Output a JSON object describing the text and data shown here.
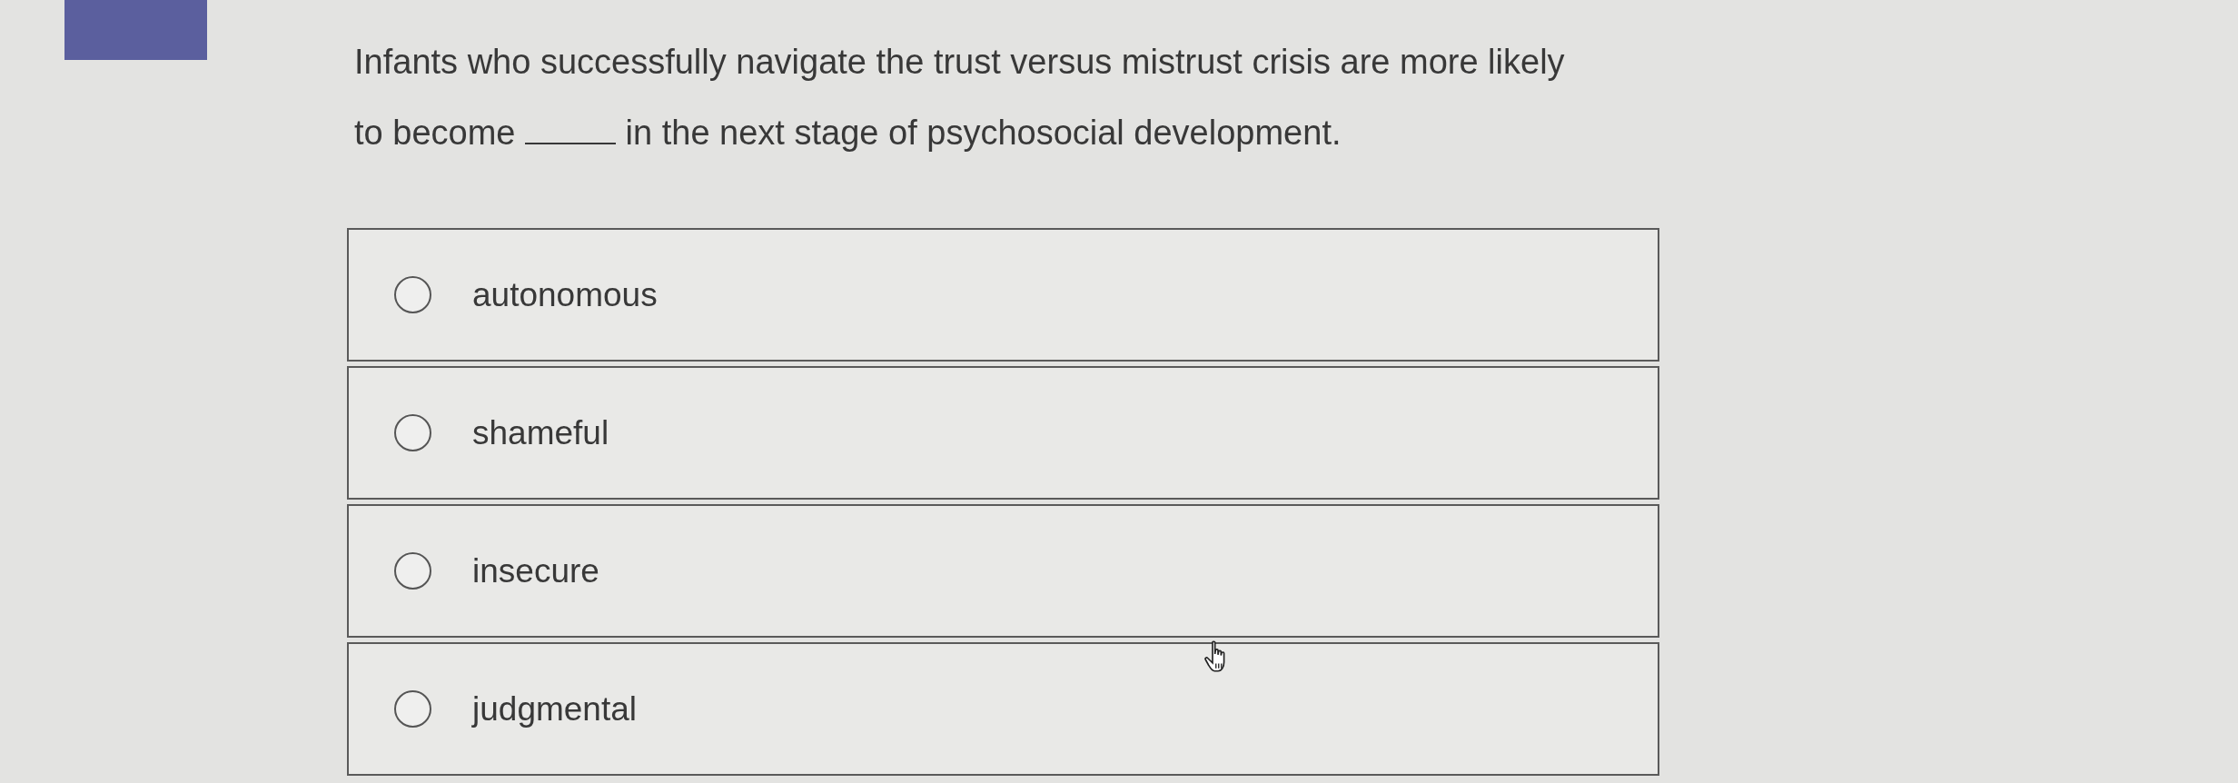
{
  "question": {
    "before_blank": "Infants who successfully navigate the trust versus mistrust crisis are more likely to become",
    "after_blank": "in the next stage of psychosocial development."
  },
  "options": [
    {
      "label": "autonomous",
      "selected": false
    },
    {
      "label": "shameful",
      "selected": false
    },
    {
      "label": "insecure",
      "selected": false
    },
    {
      "label": "judgmental",
      "selected": false
    }
  ]
}
